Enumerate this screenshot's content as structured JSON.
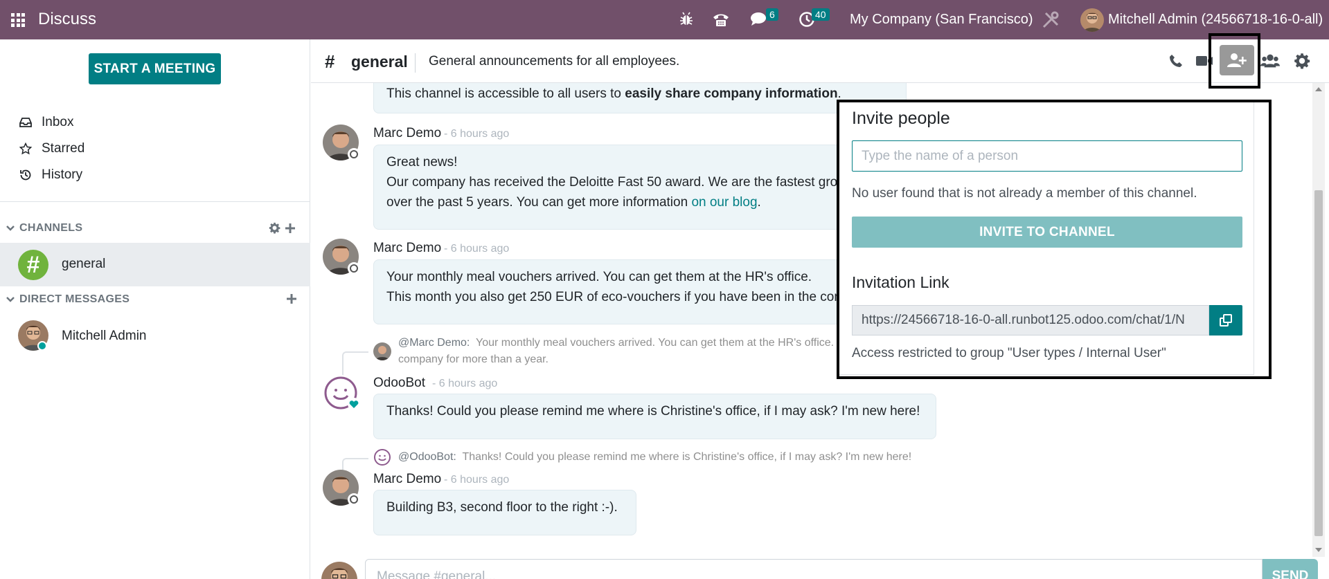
{
  "navbar": {
    "app_title": "Discuss",
    "messages_count": "6",
    "activities_count": "40",
    "company": "My Company (San Francisco)",
    "user": "Mitchell Admin (24566718-16-0-all)"
  },
  "sidebar": {
    "start_meeting": "START A MEETING",
    "mailboxes": [
      "Inbox",
      "Starred",
      "History"
    ],
    "channels_header": "CHANNELS",
    "channels": [
      {
        "name": "general"
      }
    ],
    "dm_header": "DIRECT MESSAGES",
    "direct_messages": [
      {
        "name": "Mitchell Admin"
      }
    ]
  },
  "thread": {
    "name": "general",
    "description": "General announcements for all employees.",
    "messages": [
      {
        "lines": [
          "This channel is accessible to all users to ",
          "easily share company information",
          "."
        ]
      },
      {
        "author": "Marc Demo",
        "time": "- 6 hours ago",
        "lines": [
          "Great news!",
          "Our company has received the Deloitte Fast 50 award. We are the fastest growing",
          "over the past 5 years. You can get more information ",
          "on our blog",
          "."
        ]
      },
      {
        "author": "Marc Demo",
        "time": "- 6 hours ago",
        "lines": [
          "Your monthly meal vouchers arrived. You can get them at the HR's office.",
          "This month you also get 250 EUR of eco-vouchers if you have been in the company"
        ]
      },
      {
        "reply_author": "@Marc Demo:",
        "reply_text_1": "Your monthly meal vouchers arrived. You can get them at the HR's office.",
        "reply_text_2": "company for more than a year.",
        "author": "OdooBot",
        "time": "- 6 hours ago",
        "lines": [
          "Thanks! Could you please remind me where is Christine's office, if I may ask? I'm new here!"
        ]
      },
      {
        "reply_author": "@OdooBot:",
        "reply_text_1": "Thanks! Could you please remind me where is Christine's office, if I may ask? I'm new here!",
        "author": "Marc Demo",
        "time": "- 6 hours ago",
        "lines": [
          "Building B3, second floor to the right :-)."
        ]
      }
    ]
  },
  "invite": {
    "title": "Invite people",
    "placeholder": "Type the name of a person",
    "no_user": "No user found that is not already a member of this channel.",
    "button": "INVITE TO CHANNEL",
    "link_title": "Invitation Link",
    "link": "https://24566718-16-0-all.runbot125.odoo.com/chat/1/N",
    "restriction": "Access restricted to group \"User types / Internal User\""
  },
  "composer": {
    "placeholder": "Message #general...",
    "send": "SEND"
  },
  "colors": {
    "navbar": "#71506a",
    "primary": "#017e84",
    "channel_avatar": "#70b33d"
  }
}
